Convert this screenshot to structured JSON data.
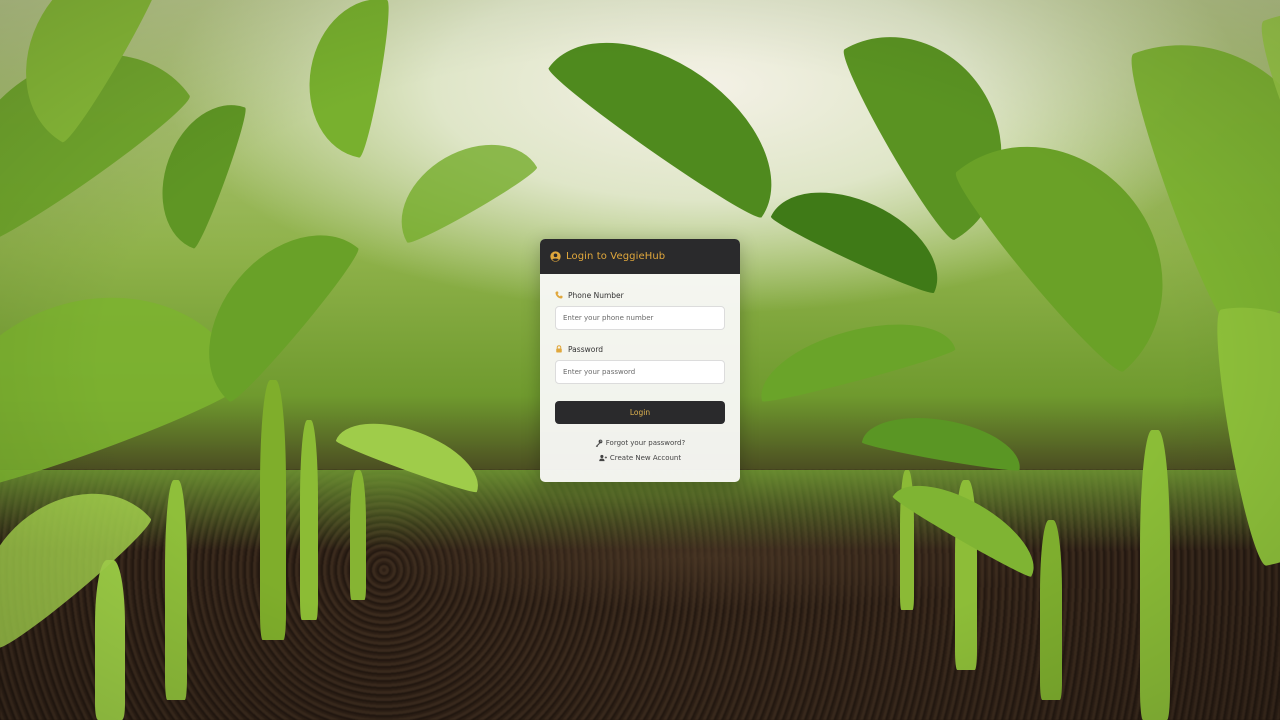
{
  "login": {
    "title": "Login to VeggieHub",
    "phone_label": "Phone Number",
    "phone_placeholder": "Enter your phone number",
    "phone_value": "",
    "password_label": "Password",
    "password_placeholder": "Enter your password",
    "password_value": "",
    "submit_label": "Login",
    "forgot_label": "Forgot your password?",
    "create_label": "Create New Account"
  },
  "icons": {
    "header": "user-circle-icon",
    "phone": "phone-icon",
    "password": "lock-icon",
    "forgot": "key-icon",
    "create": "user-plus-icon"
  },
  "colors": {
    "header_bg": "#2a2a2c",
    "accent": "#e0a73c",
    "card_bg": "#f8f8f6"
  }
}
